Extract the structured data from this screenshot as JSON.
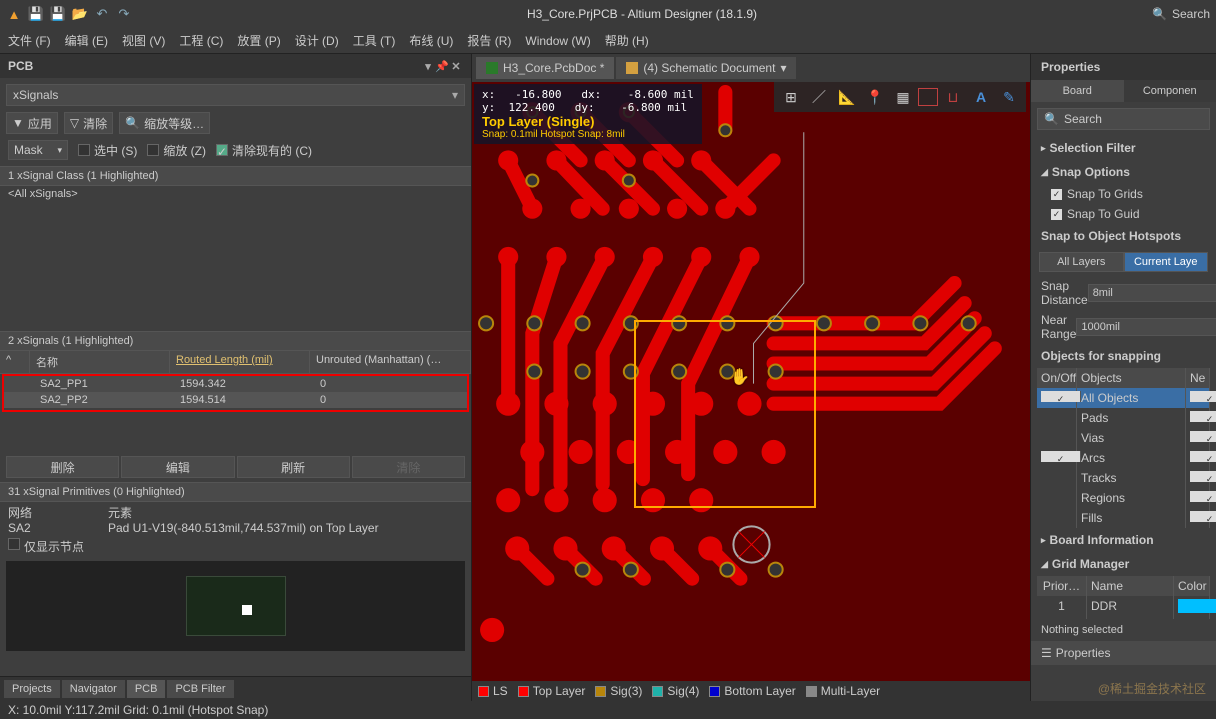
{
  "titlebar": {
    "title": "H3_Core.PrjPCB - Altium Designer (18.1.9)",
    "search_ph": "Search"
  },
  "menu": [
    "文件 (F)",
    "编辑 (E)",
    "视图 (V)",
    "工程 (C)",
    "放置 (P)",
    "设计 (D)",
    "工具 (T)",
    "布线 (U)",
    "报告 (R)",
    "Window (W)",
    "帮助 (H)"
  ],
  "left": {
    "panel": "PCB",
    "dropdown": "xSignals",
    "btns": {
      "apply": "应用",
      "clear": "清除",
      "zoom": "缩放等级…"
    },
    "mask": "Mask",
    "cks": {
      "sel": "选中 (S)",
      "scale": "缩放 (Z)",
      "clr": "清除现有的 (C)"
    },
    "class_hdr": "1 xSignal Class (1 Highlighted)",
    "class_row": "<All xSignals>",
    "sig_hdr": "2 xSignals (1 Highlighted)",
    "cols": {
      "c1": "^",
      "c2": "名称",
      "c3": "Routed Length (mil)",
      "c4": "Unrouted (Manhattan) (…"
    },
    "rows": [
      {
        "c2": "SA2_PP1",
        "c3": "1594.342",
        "c4": "0"
      },
      {
        "c2": "SA2_PP2",
        "c3": "1594.514",
        "c4": "0"
      }
    ],
    "actions": {
      "del": "删除",
      "edit": "编辑",
      "refresh": "刷新",
      "clr": "清除"
    },
    "prim_hdr": "31 xSignal Primitives (0 Highlighted)",
    "net": {
      "lbl1": "网络",
      "lbl2": "元素",
      "v1": "SA2",
      "v2": "Pad U1-V19(-840.513mil,744.537mil) on Top Layer",
      "ck": "仅显示节点"
    },
    "tabs": [
      "Projects",
      "Navigator",
      "PCB",
      "PCB Filter"
    ]
  },
  "docs": [
    {
      "name": "H3_Core.PcbDoc *",
      "act": true
    },
    {
      "name": "(4) Schematic Document",
      "act": false
    }
  ],
  "info": {
    "coord": "x:   -16.800   dx:    -8.600 mil\ny:  122.400   dy:    -6.800 mil",
    "layer": "Top Layer (Single)",
    "snap": "Snap: 0.1mil Hotspot Snap: 8mil"
  },
  "layers": [
    {
      "c": "#ff0000",
      "n": "LS"
    },
    {
      "c": "#ff0000",
      "n": "Top Layer"
    },
    {
      "c": "#b8860b",
      "n": "Sig(3)"
    },
    {
      "c": "#20b2aa",
      "n": "Sig(4)"
    },
    {
      "c": "#0000cd",
      "n": "Bottom Layer"
    },
    {
      "c": "#888",
      "n": "Multi-Layer"
    }
  ],
  "right": {
    "title": "Properties",
    "tabs": {
      "board": "Board",
      "comp": "Componen"
    },
    "search_ph": "Search",
    "selfilter": "Selection Filter",
    "snapopt": "Snap Options",
    "snap": {
      "grids": "Snap To Grids",
      "guide": "Snap To Guid"
    },
    "hotspots": "Snap to Object Hotspots",
    "seg": {
      "all": "All Layers",
      "cur": "Current Laye"
    },
    "snapdist": {
      "lbl": "Snap Distance",
      "v": "8mil"
    },
    "nearrange": {
      "lbl": "Near Range",
      "v": "1000mil"
    },
    "objsnap": "Objects for snapping",
    "objh": {
      "c1": "On/Off",
      "c2": "Objects",
      "c3": "Ne"
    },
    "objs": [
      {
        "on": true,
        "n": "All Objects",
        "ne": true,
        "act": true
      },
      {
        "on": false,
        "n": "Pads",
        "ne": true
      },
      {
        "on": false,
        "n": "Vias",
        "ne": true
      },
      {
        "on": true,
        "n": "Arcs",
        "ne": true
      },
      {
        "on": false,
        "n": "Tracks",
        "ne": true
      },
      {
        "on": false,
        "n": "Regions",
        "ne": true
      },
      {
        "on": false,
        "n": "Fills",
        "ne": true
      }
    ],
    "boardinfo": "Board Information",
    "gridmgr": "Grid Manager",
    "gridh": {
      "c1": "Prior…",
      "c2": "Name",
      "c3": "Color"
    },
    "gridr": {
      "c1": "1",
      "c2": "DDR"
    },
    "nothing": "Nothing selected",
    "proptab": "Properties"
  },
  "watermark": "@稀土掘金技术社区",
  "status": "X: 10.0mil Y:117.2mil   Grid: 0.1mil   (Hotspot Snap)"
}
